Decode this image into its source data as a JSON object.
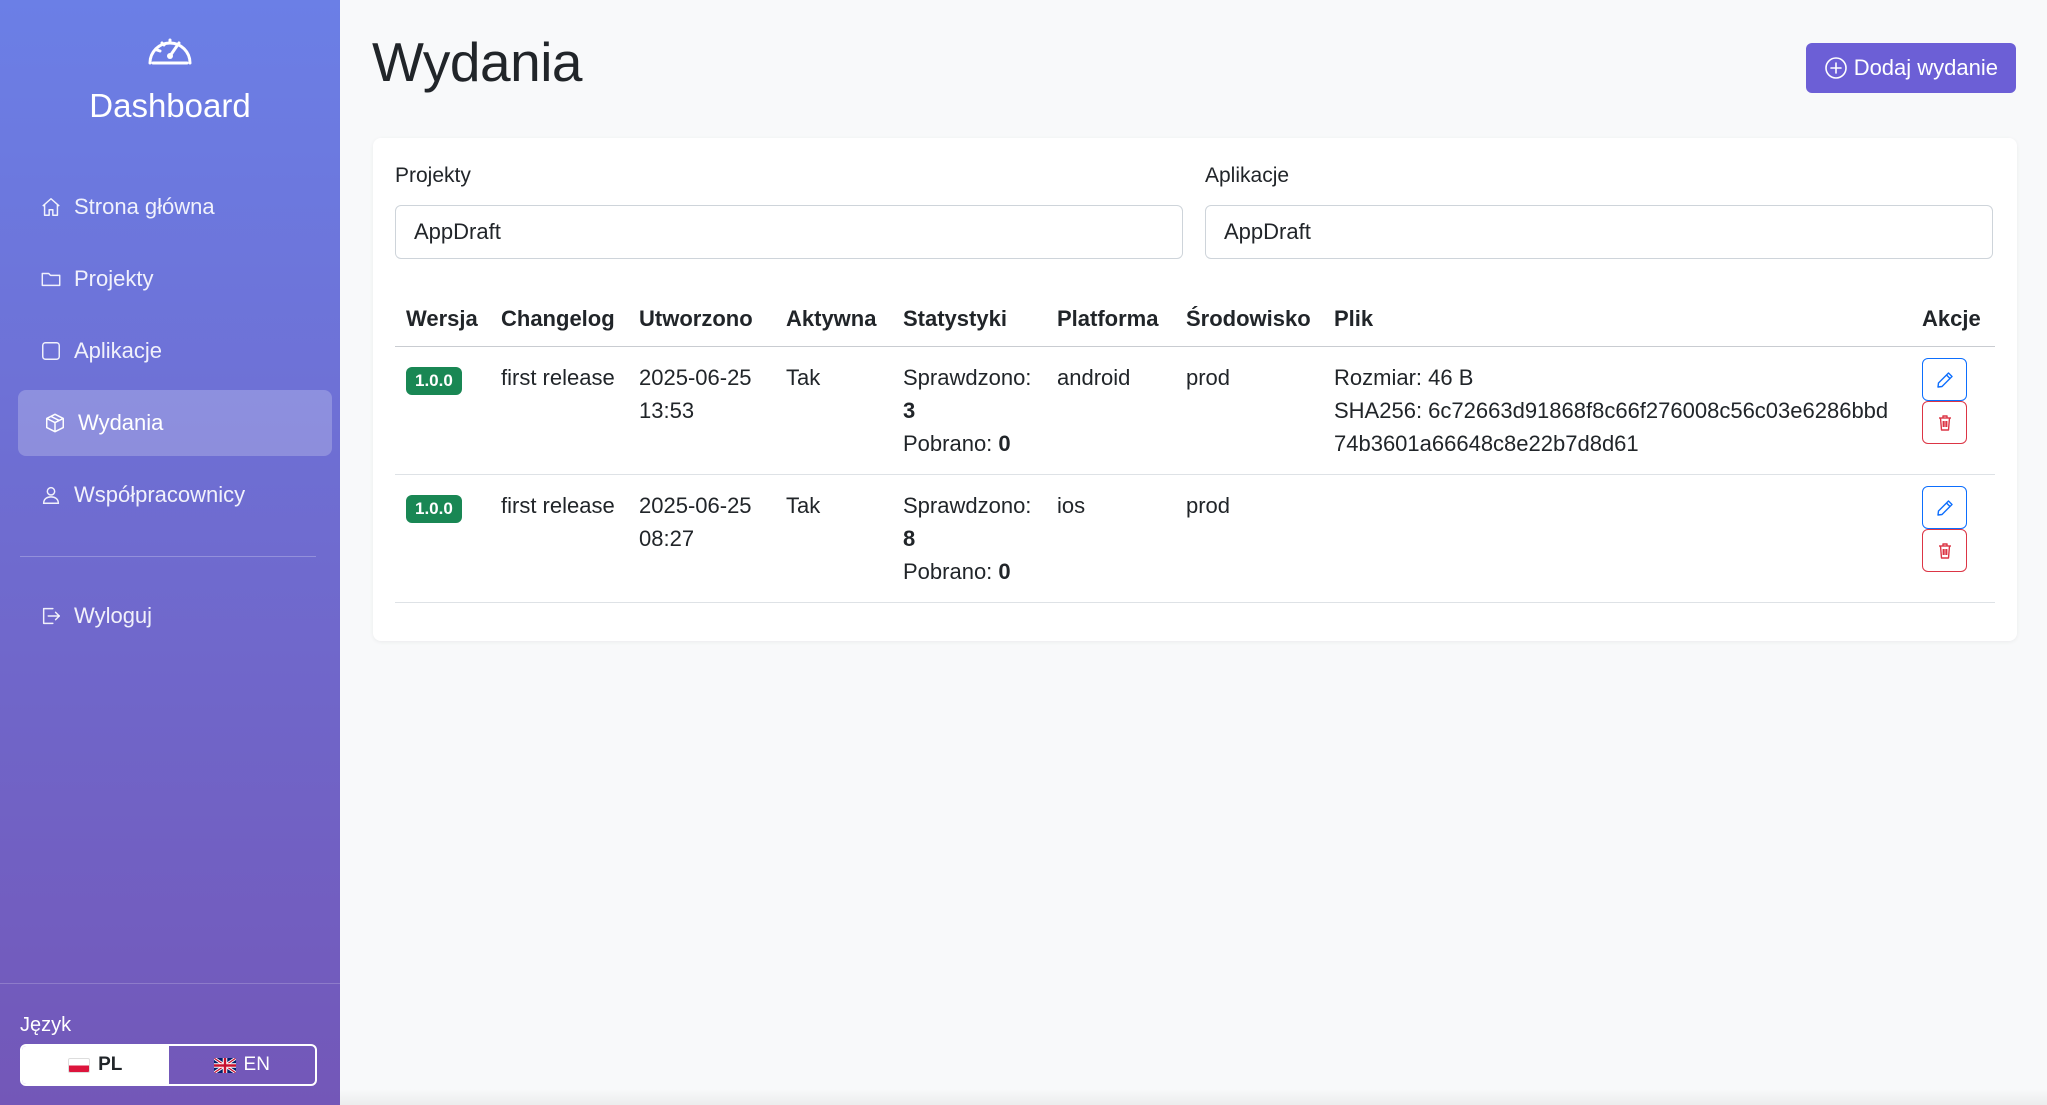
{
  "sidebar": {
    "brand_icon": "speedometer-icon",
    "title": "Dashboard",
    "items": [
      {
        "label": "Strona główna",
        "icon": "house-icon",
        "active": false
      },
      {
        "label": "Projekty",
        "icon": "folder-icon",
        "active": false
      },
      {
        "label": "Aplikacje",
        "icon": "square-icon",
        "active": false
      },
      {
        "label": "Wydania",
        "icon": "box-icon",
        "active": true
      },
      {
        "label": "Współpracownicy",
        "icon": "person-icon",
        "active": false
      }
    ],
    "logout_label": "Wyloguj",
    "language": {
      "label": "Język",
      "options": [
        {
          "code": "PL",
          "selected": true
        },
        {
          "code": "EN",
          "selected": false
        }
      ]
    }
  },
  "main": {
    "title": "Wydania",
    "add_button_label": "Dodaj wydanie",
    "filters": {
      "projects_label": "Projekty",
      "projects_value": "AppDraft",
      "apps_label": "Aplikacje",
      "apps_value": "AppDraft"
    },
    "table": {
      "columns": [
        "Wersja",
        "Changelog",
        "Utworzono",
        "Aktywna",
        "Statystyki",
        "Platforma",
        "Środowisko",
        "Plik",
        "Akcje"
      ],
      "rows": [
        {
          "version": "1.0.0",
          "changelog": "first release",
          "created": "2025-06-25 13:53",
          "active": "Tak",
          "checked_label": "Sprawdzono:",
          "checked_value": "3",
          "downloaded_label": "Pobrano:",
          "downloaded_value": "0",
          "platform": "android",
          "environment": "prod",
          "file_size": "Rozmiar: 46 B",
          "file_sha": "SHA256: 6c72663d91868f8c66f276008c56c03e6286bbd74b3601a66648c8e22b7d8d61"
        },
        {
          "version": "1.0.0",
          "changelog": "first release",
          "created": "2025-06-25 08:27",
          "active": "Tak",
          "checked_label": "Sprawdzono:",
          "checked_value": "8",
          "downloaded_label": "Pobrano:",
          "downloaded_value": "0",
          "platform": "ios",
          "environment": "prod",
          "file_size": "",
          "file_sha": ""
        }
      ]
    }
  },
  "colors": {
    "sidebar_top": "#6b7fe6",
    "sidebar_bottom": "#7357b8",
    "accent": "#6c5fd6",
    "badge": "#198754",
    "edit": "#0d6efd",
    "delete": "#dc3545"
  }
}
